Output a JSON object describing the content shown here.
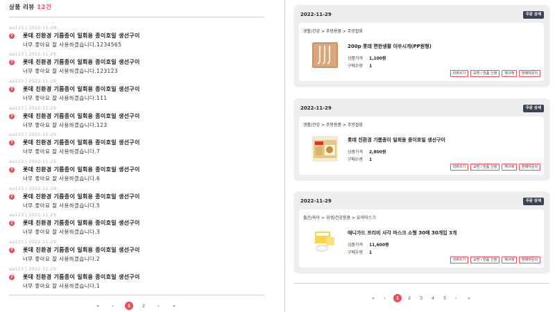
{
  "left": {
    "header_label": "상품 리뷰",
    "count": "12건",
    "reviews": [
      {
        "meta": "aa123 | 2022-11-29",
        "title": "롯데 친환경 기름종이 일회용 종이호일 생선구이",
        "body": "너무 좋아요 잘 사용하겠습니다.1234565"
      },
      {
        "meta": "aa123 | 2022-11-29",
        "title": "롯데 친환경 기름종이 일회용 종이호일 생선구이",
        "body": "너무 좋아요 잘 사용하겠습니다.123123"
      },
      {
        "meta": "aa123 | 2022-11-29",
        "title": "롯데 친환경 기름종이 일회용 종이호일 생선구이",
        "body": "너무 좋아요 잘 사용하겠습니다.111"
      },
      {
        "meta": "aa123 | 2022-11-29",
        "title": "롯데 친환경 기름종이 일회용 종이호일 생선구이",
        "body": "너무 좋아요 잘 사용하겠습니다.123"
      },
      {
        "meta": "aa123 | 2022-11-29",
        "title": "롯데 친환경 기름종이 일회용 종이호일 생선구이",
        "body": "너무 좋아요 잘 사용하겠습니다.7"
      },
      {
        "meta": "aa123 | 2022-11-29",
        "title": "롯데 친환경 기름종이 일회용 종이호일 생선구이",
        "body": "너무 좋아요 잘 사용하겠습니다.6"
      },
      {
        "meta": "aa123 | 2022-11-29",
        "title": "롯데 친환경 기름종이 일회용 종이호일 생선구이",
        "body": "너무 좋아요 잘 사용하겠습니다.5"
      },
      {
        "meta": "aa123 | 2022-11-29",
        "title": "롯데 친환경 기름종이 일회용 종이호일 생선구이",
        "body": "너무 좋아요 잘 사용하겠습니다.3"
      },
      {
        "meta": "aa123 | 2022-11-29",
        "title": "롯데 친환경 기름종이 일회용 종이호일 생선구이",
        "body": "너무 좋아요 잘 사용하겠습니다.2"
      },
      {
        "meta": "aa123 | 2022-11-29",
        "title": "롯데 친환경 기름종이 일회용 종이호일 생선구이",
        "body": "너무 좋아요 잘 사용하겠습니다.1"
      }
    ],
    "pager": {
      "first": "«",
      "prev": "‹",
      "pages": [
        "1",
        "2"
      ],
      "next": "›",
      "last": "»"
    }
  },
  "right": {
    "orders": [
      {
        "date": "2022-11-29",
        "detail_label": "주문 상세",
        "category": "생활/건강 > 주방용품 > 주방잡화",
        "product": "200p 롯데 편한생활 이쑤시개(PP원형)",
        "price_label": "상품가격",
        "price": "1,100원",
        "qty_label": "구매수량",
        "qty": "1",
        "thumb_icon": "toothpick-product-icon"
      },
      {
        "date": "2022-11-29",
        "detail_label": "주문 상세",
        "category": "생활/건강 > 주방용품 > 주방잡화",
        "product": "롯데 친환경 기름종이 일회용 종이호일 생선구이",
        "price_label": "상품가격",
        "price": "2,800원",
        "qty_label": "구매수량",
        "qty": "1",
        "thumb_icon": "paper-foil-product-icon"
      },
      {
        "date": "2022-11-29",
        "detail_label": "주문 상세",
        "category": "출산/육아 > 위생/건강용품 > 유아마스크",
        "product": "애니가드 프리비 사각 마스크 소형 30매 30개입 3개",
        "price_label": "상품가격",
        "price": "11,600원",
        "qty_label": "구매수량",
        "qty": "1",
        "thumb_icon": "mask-product-icon"
      }
    ],
    "actions": [
      "리뷰쓰기",
      "교환 / 반품 신청",
      "재구매",
      "판매자문의"
    ],
    "pager": {
      "first": "«",
      "prev": "‹",
      "pages": [
        "1",
        "2",
        "3",
        "4",
        "5"
      ],
      "next": "›",
      "last": "»"
    }
  },
  "colors": {
    "accent": "#e8505b",
    "badge": "#3b4254",
    "card_bg": "#eeeeee"
  }
}
